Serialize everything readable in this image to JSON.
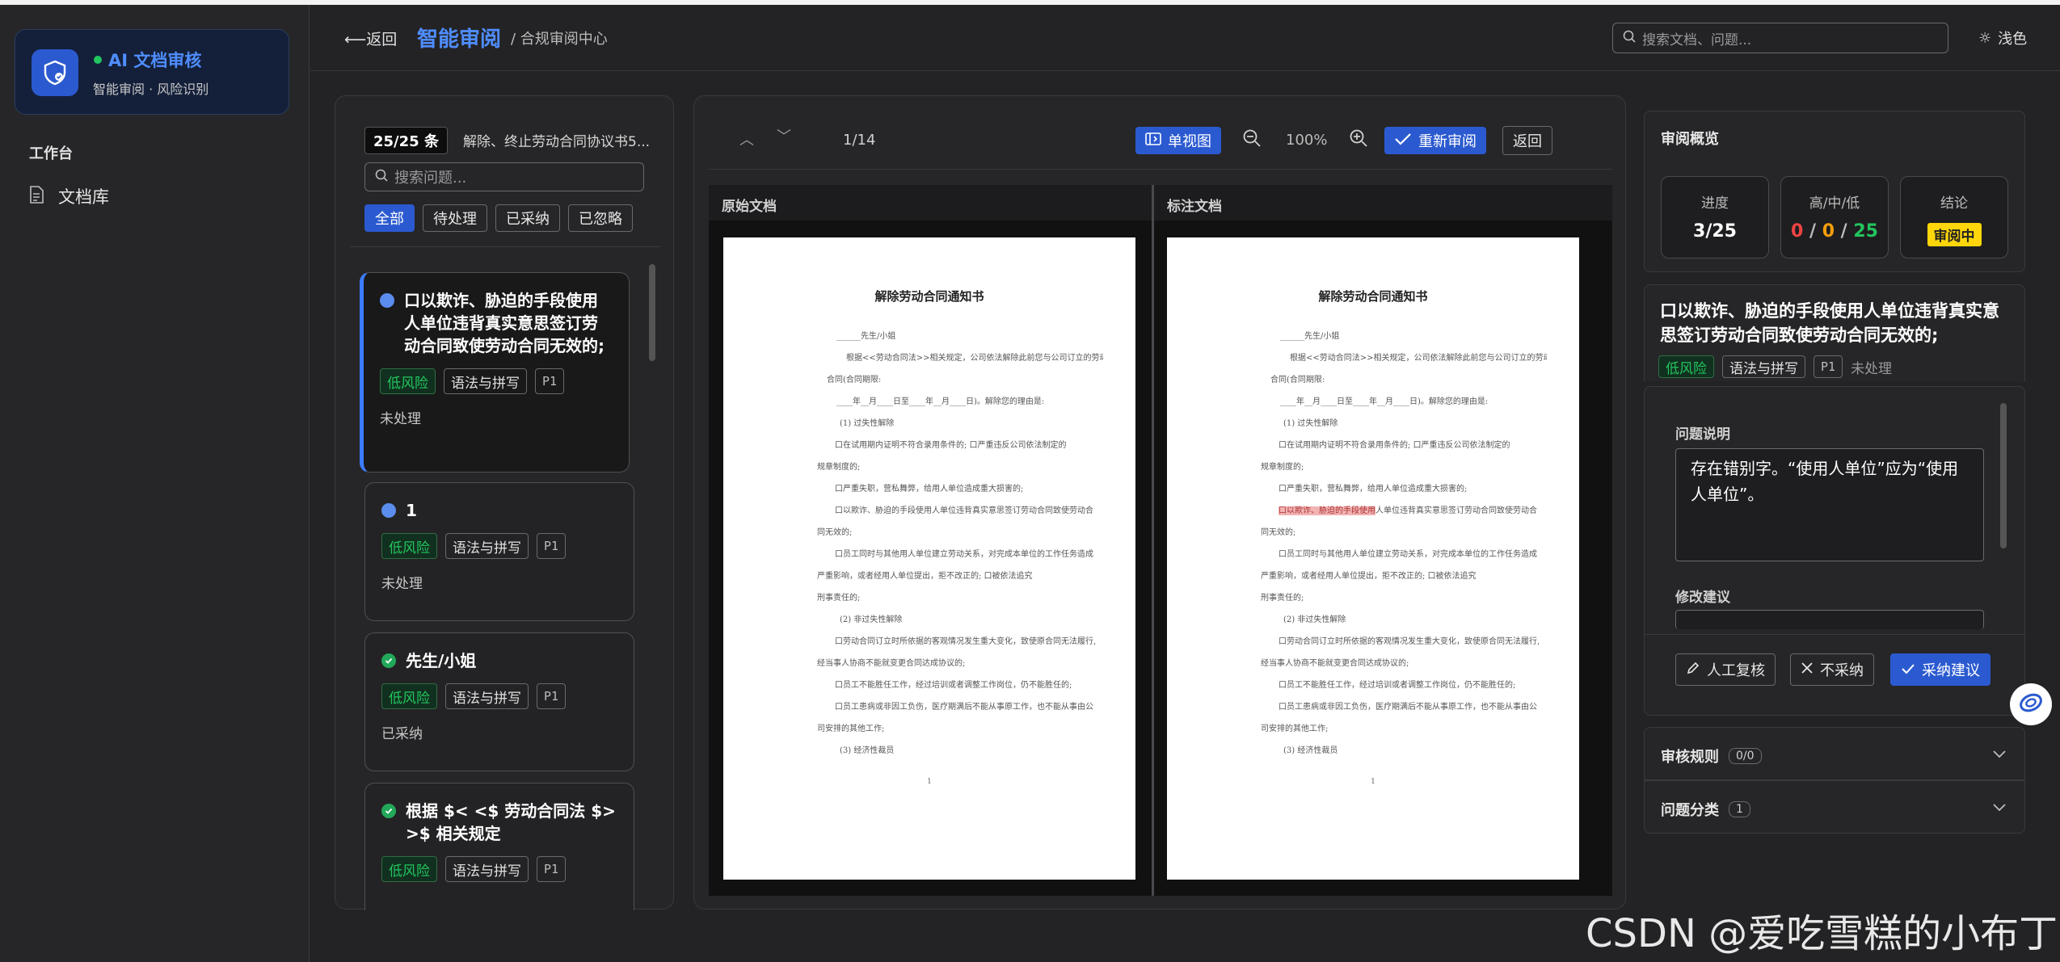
{
  "sidebar": {
    "brand_title": "AI 文档审核",
    "brand_subtitle": "智能审阅 · 风险识别",
    "section_label": "工作台",
    "nav_doc_library": "文档库"
  },
  "header": {
    "back_label": "⟵返回",
    "logo_text": "智能审阅",
    "breadcrumb": "/ 合规审阅中心",
    "search_placeholder": "搜索文档、问题...",
    "theme_label": "浅色"
  },
  "issues_panel": {
    "count_badge": "25/25 条",
    "doc_title": "解除、终止劳动合同协议书5...",
    "search_placeholder": "搜索问题...",
    "filters": [
      "全部",
      "待处理",
      "已采纳",
      "已忽略"
    ],
    "cards": [
      {
        "title": "口以欺诈、胁迫的手段使用人单位违背真实意思签订劳动合同致使劳动合同无效的;",
        "tags": [
          "低风险",
          "语法与拼写",
          "P1"
        ],
        "status": "未处理"
      },
      {
        "title": "1",
        "tags": [
          "低风险",
          "语法与拼写",
          "P1"
        ],
        "status": "未处理"
      },
      {
        "title": "先生/小姐",
        "tags": [
          "低风险",
          "语法与拼写",
          "P1"
        ],
        "status": "已采纳"
      },
      {
        "title": "根据 $< <$ 劳动合同法 $> >$ 相关规定",
        "tags": [
          "低风险",
          "语法与拼写",
          "P1"
        ],
        "status": ""
      }
    ]
  },
  "viewer": {
    "page_indicator": "1/14",
    "single_view_label": "单视图",
    "zoom": "100%",
    "rereview_label": "重新审阅",
    "return_label": "返回",
    "original_label": "原始文档",
    "annotated_label": "标注文档",
    "doc": {
      "title": "解除劳动合同通知书",
      "lines": [
        "______先生/小姐",
        "根据<<劳动合同法>>相关规定，公司依法解除此前您与公司订立的劳动",
        "合同(合同期限:",
        "____年__月____日至____年__月____日)。解除您的理由是:",
        "(1) 过失性解除",
        "口在试用期内证明不符合录用条件的;          口严重违反公司依法制定的",
        "规章制度的;",
        "口严重失职，营私舞弊，给用人单位造成重大损害的;",
        "口以欺诈、胁迫的手段使用人单位违背真实意思签订劳动合同致使劳动合",
        "同无效的;",
        "口员工同时与其他用人单位建立劳动关系，对完成本单位的工作任务造成",
        "严重影响，或者经用人单位提出，拒不改正的;                口被依法追究",
        "刑事责任的;",
        "(2) 非过失性解除",
        "口劳动合同订立时所依据的客观情况发生重大变化，致使原合同无法履行,",
        "经当事人协商不能就变更合同达成协议的;",
        "口员工不能胜任工作，经过培训或者调整工作岗位，仍不能胜任的;",
        "口员工患病或非因工负伤，医疗期满后不能从事原工作，也不能从事由公",
        "司安排的其他工作;",
        "(3) 经济性裁员"
      ],
      "highlight_text": "口以欺诈、胁迫的手段使用",
      "highlight_rest": "人单位违背真实意思签订劳动合同致使劳动合",
      "page_number": "1"
    }
  },
  "overview": {
    "title": "审阅概览",
    "progress_label": "进度",
    "progress_value": "3/25",
    "hml_label": "高/中/低",
    "high": "0",
    "mid": "0",
    "low": "25",
    "sep": " / ",
    "conclusion_label": "结论",
    "conclusion_value": "审阅中",
    "colors": {
      "high": "#ef4444",
      "mid": "#f59e0b",
      "low": "#22c55e"
    }
  },
  "detail": {
    "title": "口以欺诈、胁迫的手段使用人单位违背真实意思签订劳动合同致使劳动合同无效的;",
    "tags": [
      "低风险",
      "语法与拼写",
      "P1"
    ],
    "status": "未处理",
    "issue_label": "问题说明",
    "issue_text": "存在错别字。“使用人单位”应为“使用人单位”。",
    "suggestion_label": "修改建议",
    "manual_review_label": "人工复核",
    "reject_label": "不采纳",
    "accept_label": "采纳建议"
  },
  "accordions": [
    {
      "label": "审核规则",
      "count": "0/0"
    },
    {
      "label": "问题分类",
      "count": "1"
    }
  ],
  "watermark": "CSDN @爱吃雪糕的小布丁"
}
